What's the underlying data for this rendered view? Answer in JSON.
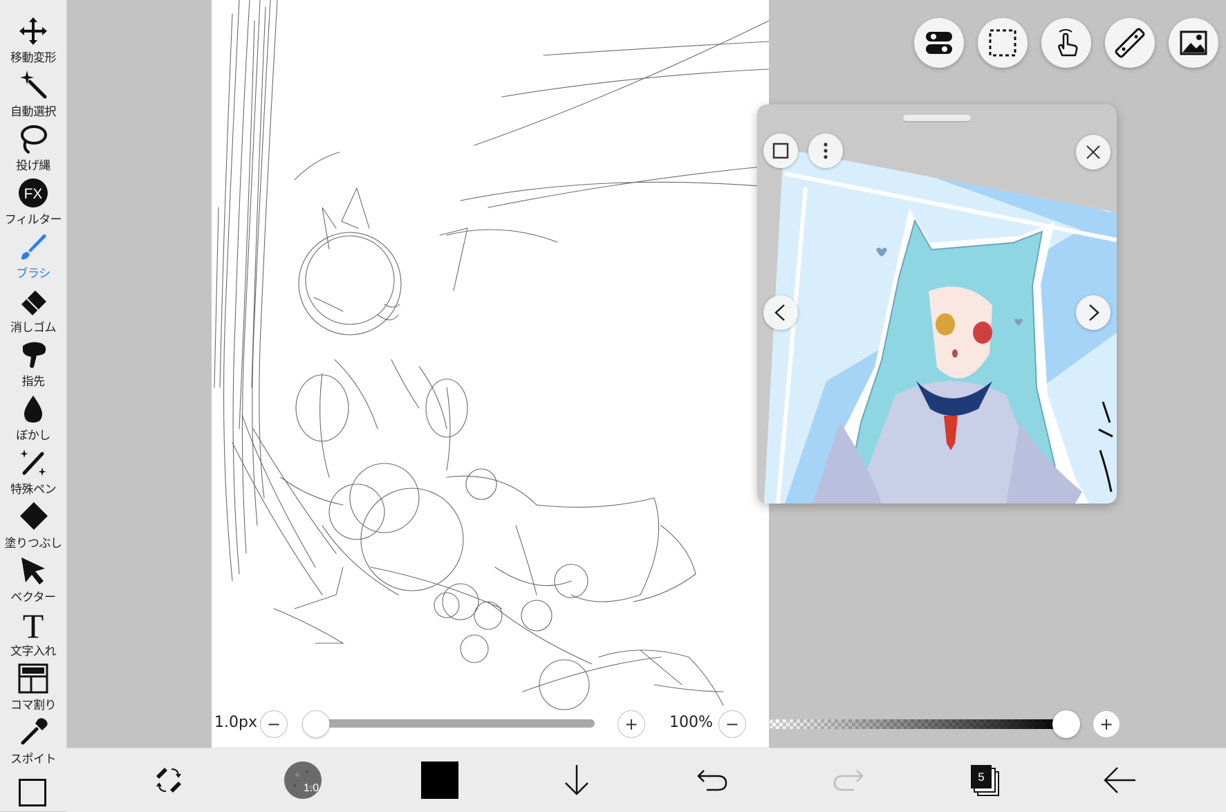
{
  "toolbar": {
    "items": [
      {
        "label": "移動変形",
        "icon": "move-arrows-icon"
      },
      {
        "label": "自動選択",
        "icon": "magic-wand-icon"
      },
      {
        "label": "投げ縄",
        "icon": "lasso-icon"
      },
      {
        "label": "フィルター",
        "icon": "fx-filter-icon"
      },
      {
        "label": "ブラシ",
        "icon": "brush-icon",
        "active": true
      },
      {
        "label": "消しゴム",
        "icon": "eraser-icon"
      },
      {
        "label": "指先",
        "icon": "finger-smudge-icon"
      },
      {
        "label": "ぼかし",
        "icon": "blur-drop-icon"
      },
      {
        "label": "特殊ペン",
        "icon": "special-pen-icon"
      },
      {
        "label": "塗りつぶし",
        "icon": "fill-bucket-icon"
      },
      {
        "label": "ベクター",
        "icon": "vector-cursor-icon"
      },
      {
        "label": "文字入れ",
        "icon": "text-t-icon"
      },
      {
        "label": "コマ割り",
        "icon": "frame-divide-icon"
      },
      {
        "label": "スポイト",
        "icon": "eyedropper-icon"
      }
    ],
    "fx_text": "FX",
    "text_tool_glyph": "T",
    "active_color": "#2a7ff0"
  },
  "top_buttons": [
    "toggle-settings-icon",
    "selection-rect-icon",
    "touch-gesture-icon",
    "ruler-icon",
    "reference-image-icon"
  ],
  "reference_window": {
    "image_description_icon": "reference-picture",
    "buttons": [
      "window-mode-icon",
      "more-menu-icon",
      "close-icon",
      "prev-arrow-icon",
      "next-arrow-icon"
    ]
  },
  "brush": {
    "size_label": "1.0px",
    "size_fraction": 0.0,
    "opacity_label": "100%",
    "opacity_fraction": 1.0,
    "minus": "−",
    "plus": "+"
  },
  "bottom_bar": {
    "brush_size_badge": "1.0",
    "primary_color": "#000000",
    "layer_count": "5"
  }
}
